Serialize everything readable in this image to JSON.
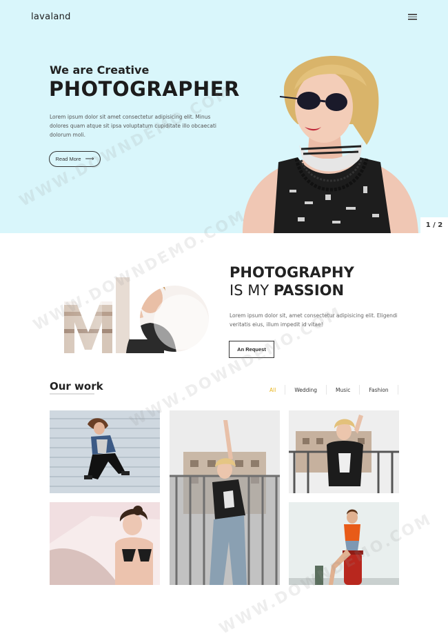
{
  "header": {
    "logo": "lavaland",
    "menu_icon": "hamburger-menu-icon"
  },
  "hero": {
    "kicker": "We are Creative",
    "title": "PHOTOGRAPHER",
    "text": "Lorem ipsum dolor sit amet consectetur adipisicing elit. Minus dolores quam atque sit ipsa voluptatum cupiditate illo obcaecati dolorum moli.",
    "button_label": "Read More",
    "button_icon": "arrow-right-icon",
    "slider_counter": "1 / 2",
    "background_color": "#d9f6fb"
  },
  "passion": {
    "title_line1": "PHOTOGRAPHY",
    "title_line2_prefix": "IS MY ",
    "title_line2_bold": "PASSION",
    "text": "Lorem ipsum dolor sit, amet consectetur adipisicing elit. Eligendi veritatis eius, illum impedit id vitae!",
    "button_label": "An Request",
    "art_letters": "ML"
  },
  "work": {
    "title": "Our work",
    "filters": [
      {
        "label": "All",
        "active": true
      },
      {
        "label": "Wedding",
        "active": false
      },
      {
        "label": "Music",
        "active": false
      },
      {
        "label": "Fashion",
        "active": false
      }
    ],
    "accent_color": "#e8b31a"
  },
  "watermark": "WWW.DOWNDEMO.COM"
}
